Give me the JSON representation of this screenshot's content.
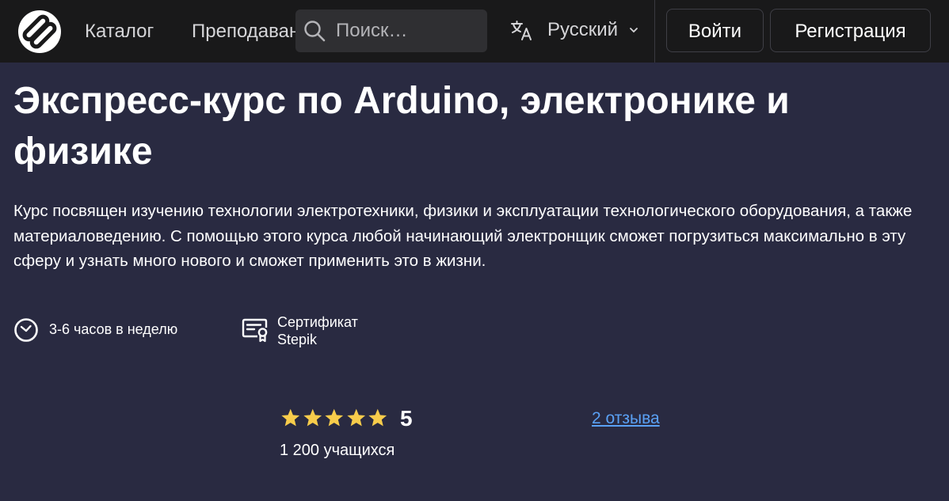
{
  "header": {
    "nav": {
      "catalog": "Каталог",
      "teach": "Преподавание"
    },
    "search": {
      "placeholder": "Поиск…"
    },
    "language": {
      "label": "Русский"
    },
    "buttons": {
      "login": "Войти",
      "register": "Регистрация"
    }
  },
  "course": {
    "title": "Экспресс-курс по Arduino, электронике и физике",
    "description": "Курс посвящен изучению технологии электротехники, физики и эксплуатации технологического оборудования, а также материаловедению. С помощью этого курса любой начинающий электронщик сможет погрузиться максимально в эту сферу и узнать много нового и сможет применить это в жизни.",
    "features": {
      "hours": "3-6 часов в неделю",
      "certificate_line1": "Сертификат",
      "certificate_line2": "Stepik"
    },
    "rating": {
      "stars": 5,
      "value": "5",
      "students": "1 200 учащихся",
      "reviews": "2 отзыва"
    }
  },
  "colors": {
    "header_bg": "#19191a",
    "page_bg": "#292a41",
    "star": "#f7cc4b",
    "link": "#5aa1f5"
  }
}
